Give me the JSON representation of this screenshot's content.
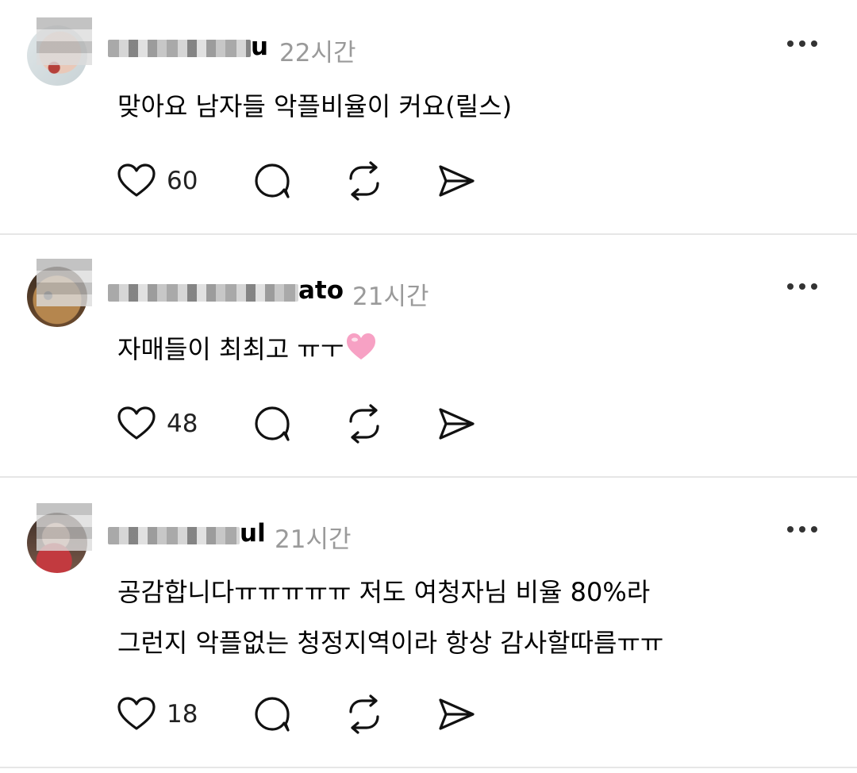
{
  "posts": [
    {
      "username_visible": "u",
      "timestamp": "22시간",
      "text_lines": [
        "맞아요 남자들 악플비율이 커요(릴스)"
      ],
      "likes": "60"
    },
    {
      "username_visible": "ato",
      "timestamp": "21시간",
      "text_lines": [
        "자매들이 최최고 ㅠㅜ"
      ],
      "likes": "48"
    },
    {
      "username_visible": "ul",
      "timestamp": "21시간",
      "text_lines": [
        "공감합니다ㅠㅠㅠㅠㅠ 저도 여청자님 비율 80%라",
        "그런지 악플없는 청정지역이라 항상 감사할따름ㅠㅠ"
      ],
      "likes": "18"
    }
  ],
  "icons": {
    "like": "heart-outline-icon",
    "reply": "speech-bubble-icon",
    "repost": "repost-arrows-icon",
    "share": "paper-plane-icon",
    "more": "ellipsis-icon",
    "emoji": "pink-heart-emoji"
  },
  "colors": {
    "text": "#000000",
    "muted": "#9a9a9a",
    "divider": "#e6e6e6",
    "emoji_heart": "#f7a1c4"
  }
}
